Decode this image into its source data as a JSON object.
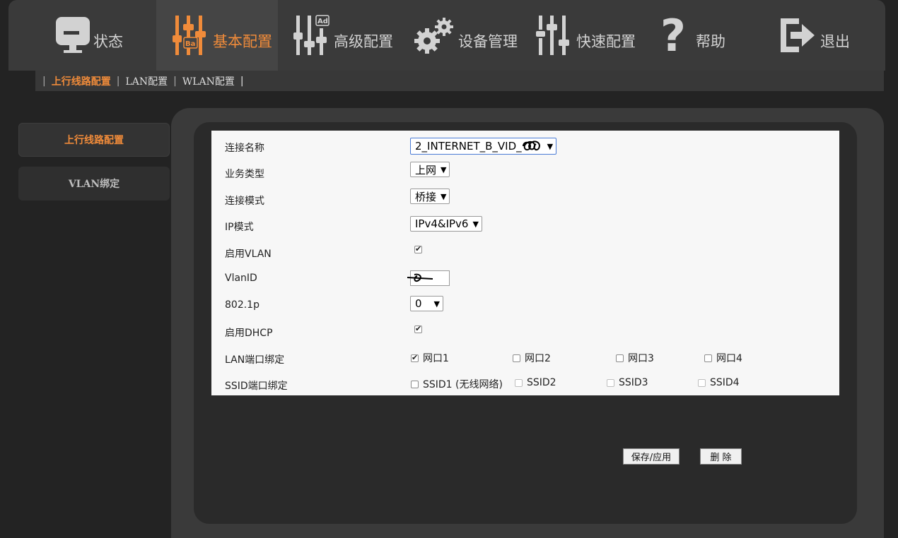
{
  "topnav": {
    "items": [
      {
        "label": "状态",
        "icon": "monitor-icon"
      },
      {
        "label": "基本配置",
        "icon": "sliders-basic-icon",
        "badge": "Ba",
        "active": true
      },
      {
        "label": "高级配置",
        "icon": "sliders-advanced-icon",
        "badge": "Ad"
      },
      {
        "label": "设备管理",
        "icon": "gears-icon"
      },
      {
        "label": "快速配置",
        "icon": "sliders-quick-icon"
      },
      {
        "label": "帮助",
        "icon": "question-icon"
      },
      {
        "label": "退出",
        "icon": "exit-icon"
      }
    ]
  },
  "subnav": {
    "items": [
      {
        "label": "上行线路配置",
        "active": true
      },
      {
        "label": "LAN配置"
      },
      {
        "label": "WLAN配置"
      }
    ],
    "divider": "|"
  },
  "sidebar": {
    "items": [
      {
        "label": "上行线路配置",
        "active": true
      },
      {
        "label": "VLAN绑定"
      }
    ]
  },
  "form": {
    "connection_name": {
      "label": "连接名称",
      "value": "2_INTERNET_B_VID_"
    },
    "service_type": {
      "label": "业务类型",
      "value": "上网"
    },
    "connection_mode": {
      "label": "连接模式",
      "value": "桥接"
    },
    "ip_mode": {
      "label": "IP模式",
      "value": "IPv4&IPv6"
    },
    "enable_vlan": {
      "label": "启用VLAN",
      "checked": true
    },
    "vlan_id": {
      "label": "VlanID",
      "value": ""
    },
    "priority_8021p": {
      "label": "802.1p",
      "value": "0"
    },
    "enable_dhcp": {
      "label": "启用DHCP",
      "checked": true
    },
    "lan_binding": {
      "label": "LAN端口绑定",
      "options": [
        {
          "label": "网口1",
          "checked": true
        },
        {
          "label": "网口2",
          "checked": false
        },
        {
          "label": "网口3",
          "checked": false
        },
        {
          "label": "网口4",
          "checked": false
        }
      ]
    },
    "ssid_binding": {
      "label": "SSID端口绑定",
      "options": [
        {
          "label": "SSID1 (无线网络)",
          "checked": false
        },
        {
          "label": "SSID2",
          "checked": false
        },
        {
          "label": "SSID3",
          "checked": false
        },
        {
          "label": "SSID4",
          "checked": false
        }
      ]
    }
  },
  "actions": {
    "save_label": "保存/应用",
    "delete_label": "删 除"
  },
  "colors": {
    "accent": "#f08b3a",
    "background": "#232323",
    "nav": "#3a3a3a"
  }
}
